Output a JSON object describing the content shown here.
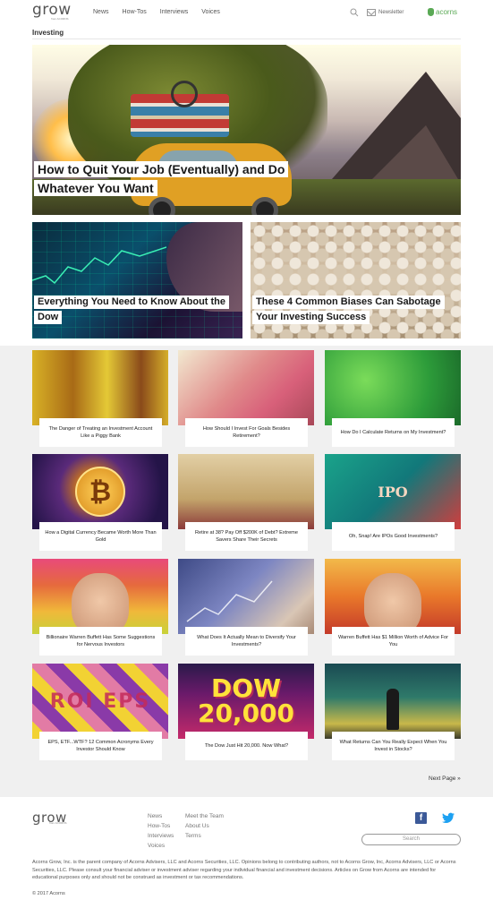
{
  "header": {
    "logo": "grow",
    "logo_sub": "from ACORNS",
    "nav": [
      "News",
      "How-Tos",
      "Interviews",
      "Voices"
    ],
    "newsletter_label": "Newsletter",
    "brand": "acorns",
    "brand_color": "#5aa955"
  },
  "section_title": "Investing",
  "hero": {
    "title_lines": [
      "How to Quit Your Job (Eventually) and Do",
      "Whatever You Want"
    ]
  },
  "features": [
    {
      "title_lines": [
        "Everything You Need to Know About the",
        "Dow"
      ]
    },
    {
      "title_lines": [
        "These 4 Common Biases Can Sabotage",
        "Your Investing Success"
      ]
    }
  ],
  "cards": [
    {
      "title": "The Danger of Treating an Investment Account Like a Piggy Bank",
      "icon": "piggy-bank-photo"
    },
    {
      "title": "How Should I Invest For Goals Besides Retirement?",
      "icon": "coins-clock-photo"
    },
    {
      "title": "How Do I Calculate Returns on My Investment?",
      "icon": "green-math-photo"
    },
    {
      "title": "How a Digital Currency Became Worth More Than Gold",
      "icon": "bitcoin-photo",
      "glyph": "₿"
    },
    {
      "title": "Retire at 38? Pay Off $200K of Debt? Extreme Savers Share Their Secrets",
      "icon": "money-rain-photo"
    },
    {
      "title": "Oh, Snap! Are IPOs Good Investments?",
      "icon": "ipo-chart-photo",
      "glyph": "IPO"
    },
    {
      "title": "Billionaire Warren Buffett Has Some Suggestions for Nervous Investors",
      "icon": "buffett-portrait-photo"
    },
    {
      "title": "What Does It Actually Mean to Diversify Your Investments?",
      "icon": "stock-chart-photo"
    },
    {
      "title": "Warren Buffett Has $1 Million Worth of Advice For You",
      "icon": "buffett-portrait-photo"
    },
    {
      "title": "EPS, ETF...WTF? 12 Common Acronyms Every Investor Should Know",
      "icon": "acronyms-collage-photo",
      "glyph": "ROI EPS"
    },
    {
      "title": "The Dow Just Hit 20,000. Now What?",
      "icon": "dow-20000-photo",
      "glyph_l1": "DOW",
      "glyph_l2": "20,000"
    },
    {
      "title": "What Returns Can You Really Expect When You Invest in Stocks?",
      "icon": "businessman-skyline-photo"
    }
  ],
  "next_page": "Next Page »",
  "footer": {
    "logo": "grow",
    "logo_sub": "from ACORNS",
    "col1": [
      "News",
      "How-Tos",
      "Interviews",
      "Voices"
    ],
    "col2": [
      "Meet the Team",
      "About Us",
      "Terms"
    ],
    "search_placeholder": "Search",
    "legal": "Acorns Grow, Inc. is the parent company of Acorns Advisers, LLC and Acorns Securities, LLC. Opinions belong to contributing authors, not to Acorns Grow, Inc, Acorns Advisers, LLC or Acorns Securities, LLC. Please consult your financial adviser or investment adviser regarding your individual financial and investment decisions. Articles on Grow from Acorns are intended for educational purposes only and should not be construed as investment or tax recommendations.",
    "copyright": "© 2017 Acorns",
    "facebook_color": "#3b5998",
    "twitter_color": "#1da1f2"
  }
}
